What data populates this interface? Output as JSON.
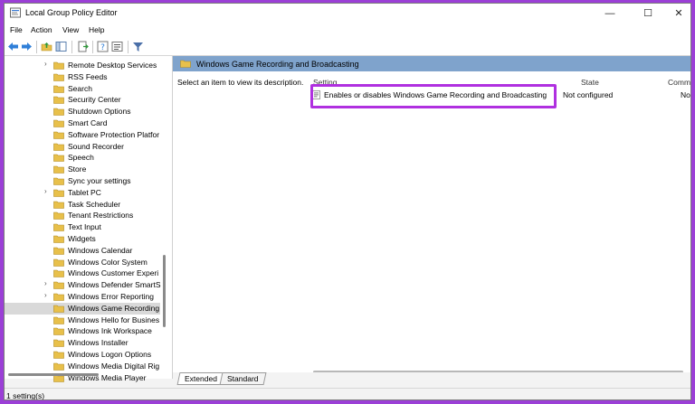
{
  "window": {
    "title": "Local Group Policy Editor",
    "controls": {
      "minimize": "—",
      "maximize": "☐",
      "close": "✕"
    }
  },
  "menu": [
    "File",
    "Action",
    "View",
    "Help"
  ],
  "toolbar": {
    "icons": [
      "back-icon",
      "forward-icon",
      "folder-up-icon",
      "show-hide-tree-icon",
      "export-list-icon",
      "help-icon",
      "properties-icon",
      "filter-icon"
    ]
  },
  "tree": {
    "items": [
      {
        "label": "Remote Desktop Services",
        "expandable": true,
        "selected": false
      },
      {
        "label": "RSS Feeds",
        "expandable": false,
        "selected": false
      },
      {
        "label": "Search",
        "expandable": false,
        "selected": false
      },
      {
        "label": "Security Center",
        "expandable": false,
        "selected": false
      },
      {
        "label": "Shutdown Options",
        "expandable": false,
        "selected": false
      },
      {
        "label": "Smart Card",
        "expandable": false,
        "selected": false
      },
      {
        "label": "Software Protection Platfor",
        "expandable": false,
        "selected": false
      },
      {
        "label": "Sound Recorder",
        "expandable": false,
        "selected": false
      },
      {
        "label": "Speech",
        "expandable": false,
        "selected": false
      },
      {
        "label": "Store",
        "expandable": false,
        "selected": false
      },
      {
        "label": "Sync your settings",
        "expandable": false,
        "selected": false
      },
      {
        "label": "Tablet PC",
        "expandable": true,
        "selected": false
      },
      {
        "label": "Task Scheduler",
        "expandable": false,
        "selected": false
      },
      {
        "label": "Tenant Restrictions",
        "expandable": false,
        "selected": false
      },
      {
        "label": "Text Input",
        "expandable": false,
        "selected": false
      },
      {
        "label": "Widgets",
        "expandable": false,
        "selected": false
      },
      {
        "label": "Windows Calendar",
        "expandable": false,
        "selected": false
      },
      {
        "label": "Windows Color System",
        "expandable": false,
        "selected": false
      },
      {
        "label": "Windows Customer Experi",
        "expandable": false,
        "selected": false
      },
      {
        "label": "Windows Defender SmartS",
        "expandable": true,
        "selected": false
      },
      {
        "label": "Windows Error Reporting",
        "expandable": true,
        "selected": false
      },
      {
        "label": "Windows Game Recording",
        "expandable": false,
        "selected": true
      },
      {
        "label": "Windows Hello for Busines",
        "expandable": false,
        "selected": false
      },
      {
        "label": "Windows Ink Workspace",
        "expandable": false,
        "selected": false
      },
      {
        "label": "Windows Installer",
        "expandable": false,
        "selected": false
      },
      {
        "label": "Windows Logon Options",
        "expandable": false,
        "selected": false
      },
      {
        "label": "Windows Media Digital Rig",
        "expandable": false,
        "selected": false
      },
      {
        "label": "Windows Media Player",
        "expandable": false,
        "selected": false
      }
    ]
  },
  "details": {
    "header": "Windows Game Recording and Broadcasting",
    "description_prompt": "Select an item to view its description.",
    "columns": {
      "setting": "Setting",
      "state": "State",
      "comment": "Comm"
    },
    "rows": [
      {
        "setting": "Enables or disables Windows Game Recording and Broadcasting",
        "state": "Not configured",
        "comment": "No"
      }
    ]
  },
  "tabs": [
    "Extended",
    "Standard"
  ],
  "status": "1 setting(s)",
  "colors": {
    "header_bar": "#7fa3cc",
    "highlight": "#b030e0",
    "folder": "#e8c04a"
  }
}
